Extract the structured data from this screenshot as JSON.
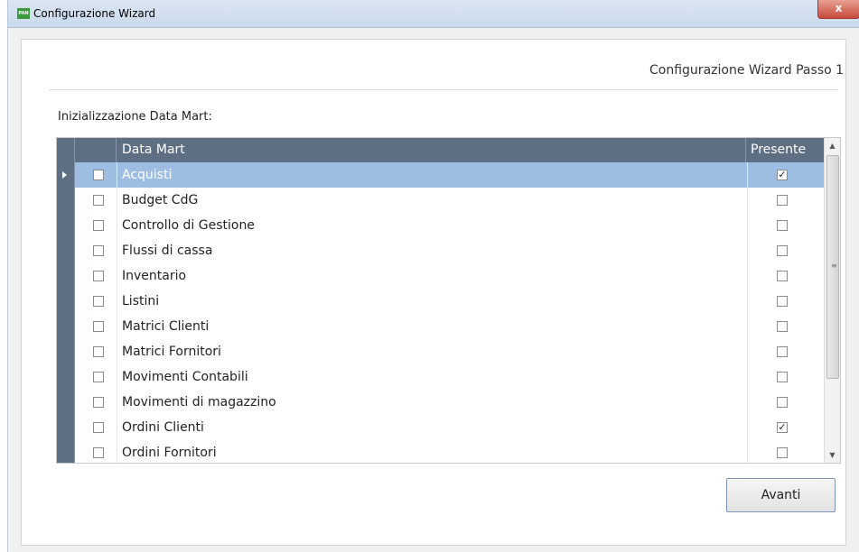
{
  "window": {
    "title": "Configurazione Wizard",
    "app_icon_label": "PAN",
    "close_label": "x"
  },
  "wizard": {
    "step_title": "Configurazione Wizard Passo 1",
    "section_label": "Inizializzazione Data Mart:"
  },
  "grid": {
    "columns": [
      "Data Mart",
      "Presente"
    ],
    "rows": [
      {
        "name": "Acquisti",
        "selected": true,
        "checked": false,
        "present": true
      },
      {
        "name": "Budget CdG",
        "selected": false,
        "checked": false,
        "present": false
      },
      {
        "name": "Controllo di Gestione",
        "selected": false,
        "checked": false,
        "present": false
      },
      {
        "name": "Flussi di cassa",
        "selected": false,
        "checked": false,
        "present": false
      },
      {
        "name": "Inventario",
        "selected": false,
        "checked": false,
        "present": false
      },
      {
        "name": "Listini",
        "selected": false,
        "checked": false,
        "present": false
      },
      {
        "name": "Matrici Clienti",
        "selected": false,
        "checked": false,
        "present": false
      },
      {
        "name": "Matrici Fornitori",
        "selected": false,
        "checked": false,
        "present": false
      },
      {
        "name": "Movimenti Contabili",
        "selected": false,
        "checked": false,
        "present": false
      },
      {
        "name": "Movimenti di magazzino",
        "selected": false,
        "checked": false,
        "present": false
      },
      {
        "name": "Ordini Clienti",
        "selected": false,
        "checked": false,
        "present": true
      },
      {
        "name": "Ordini Fornitori",
        "selected": false,
        "checked": false,
        "present": false
      }
    ]
  },
  "buttons": {
    "next_label": "Avanti"
  },
  "colors": {
    "header_bg": "#5f6f83",
    "selected_row": "#9ebde3",
    "title_bar": "#c9d9ec"
  }
}
